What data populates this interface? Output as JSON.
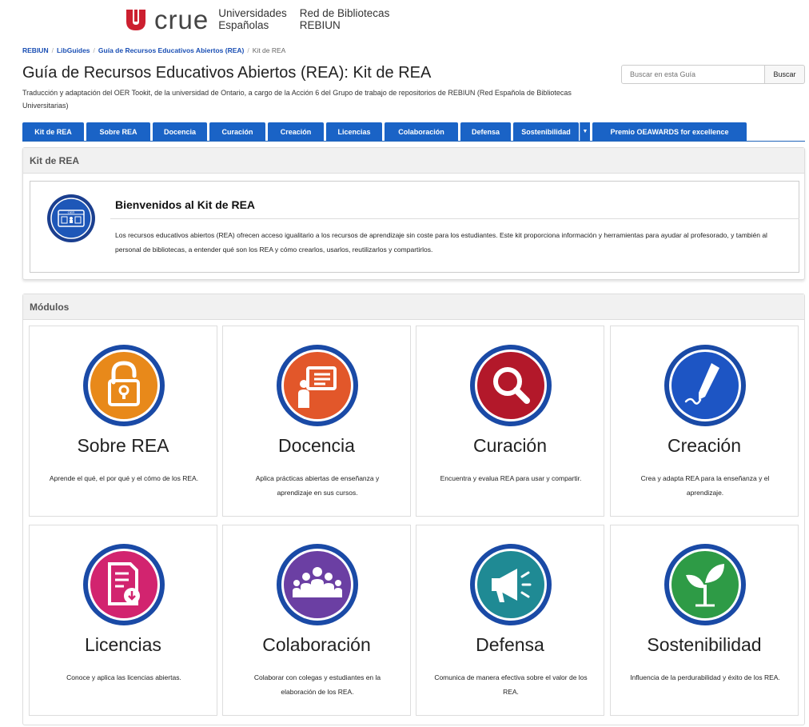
{
  "header": {
    "logo_text": "crue",
    "org_line1": "Universidades",
    "org_line2": "Españolas",
    "net_line1": "Red de Bibliotecas",
    "net_line2": "REBIUN",
    "brand_color": "#cc1f2f"
  },
  "breadcrumb": {
    "items": [
      "REBIUN",
      "LibGuides",
      "Guía de Recursos Educativos Abiertos (REA)"
    ],
    "current": "Kit de REA"
  },
  "page": {
    "title": "Guía de Recursos Educativos Abiertos (REA): Kit de REA",
    "subtitle": "Traducción y adaptación del OER Tookit, de la universidad de Ontario, a cargo de la Acción 6 del Grupo de trabajo de repositorios de REBIUN (Red Española de Bibliotecas Universitarias)"
  },
  "search": {
    "placeholder": "Buscar en esta Guía",
    "button_label": "Buscar"
  },
  "tabs": [
    {
      "label": "Kit de REA"
    },
    {
      "label": "Sobre REA"
    },
    {
      "label": "Docencia"
    },
    {
      "label": "Curación"
    },
    {
      "label": "Creación"
    },
    {
      "label": "Licencias"
    },
    {
      "label": "Colaboración"
    },
    {
      "label": "Defensa"
    },
    {
      "label": "Sostenibilidad"
    },
    {
      "label": "Premio OEAWARDS for excellence"
    }
  ],
  "intro_panel": {
    "heading": "Kit de REA",
    "badge_label": "OER",
    "welcome_title": "Bienvenidos al Kit de REA",
    "welcome_text": "Los recursos educativos abiertos (REA) ofrecen acceso igualitario a los recursos de aprendizaje sin coste para los estudiantes. Este kit proporciona información y herramientas para ayudar al profesorado, y también al personal de bibliotecas, a entender qué son los REA y cómo crearlos, usarlos, reutilizarlos y compartirlos."
  },
  "modules": {
    "heading": "Módulos",
    "cards": [
      {
        "title": "Sobre REA",
        "desc": "Aprende el qué, el por qué y el cómo de los REA.",
        "icon": "unlock-icon",
        "color": "#e8891a"
      },
      {
        "title": "Docencia",
        "desc": "Aplica prácticas abiertas de enseñanza y aprendizaje en sus cursos.",
        "icon": "presentation-icon",
        "color": "#e2572a"
      },
      {
        "title": "Curación",
        "desc": "Encuentra y evalua REA para usar y compartir.",
        "icon": "search-icon",
        "color": "#b3182a"
      },
      {
        "title": "Creación",
        "desc": "Crea y adapta REA para la enseñanza y el aprendizaje.",
        "icon": "pen-icon",
        "color": "#1d55c4"
      },
      {
        "title": "Licencias",
        "desc": "Conoce y aplica las licencias abiertas.",
        "icon": "document-download-icon",
        "color": "#d2246f"
      },
      {
        "title": "Colaboración",
        "desc": "Colaborar con colegas y estudiantes en la elaboración de los REA.",
        "icon": "people-group-icon",
        "color": "#6b3fa3"
      },
      {
        "title": "Defensa",
        "desc": "Comunica de manera efectiva sobre el valor de los REA.",
        "icon": "megaphone-icon",
        "color": "#1f8a94"
      },
      {
        "title": "Sostenibilidad",
        "desc": "Influencia de la perdurabilidad y éxito de los REA.",
        "icon": "plant-icon",
        "color": "#2e9b46"
      }
    ]
  }
}
